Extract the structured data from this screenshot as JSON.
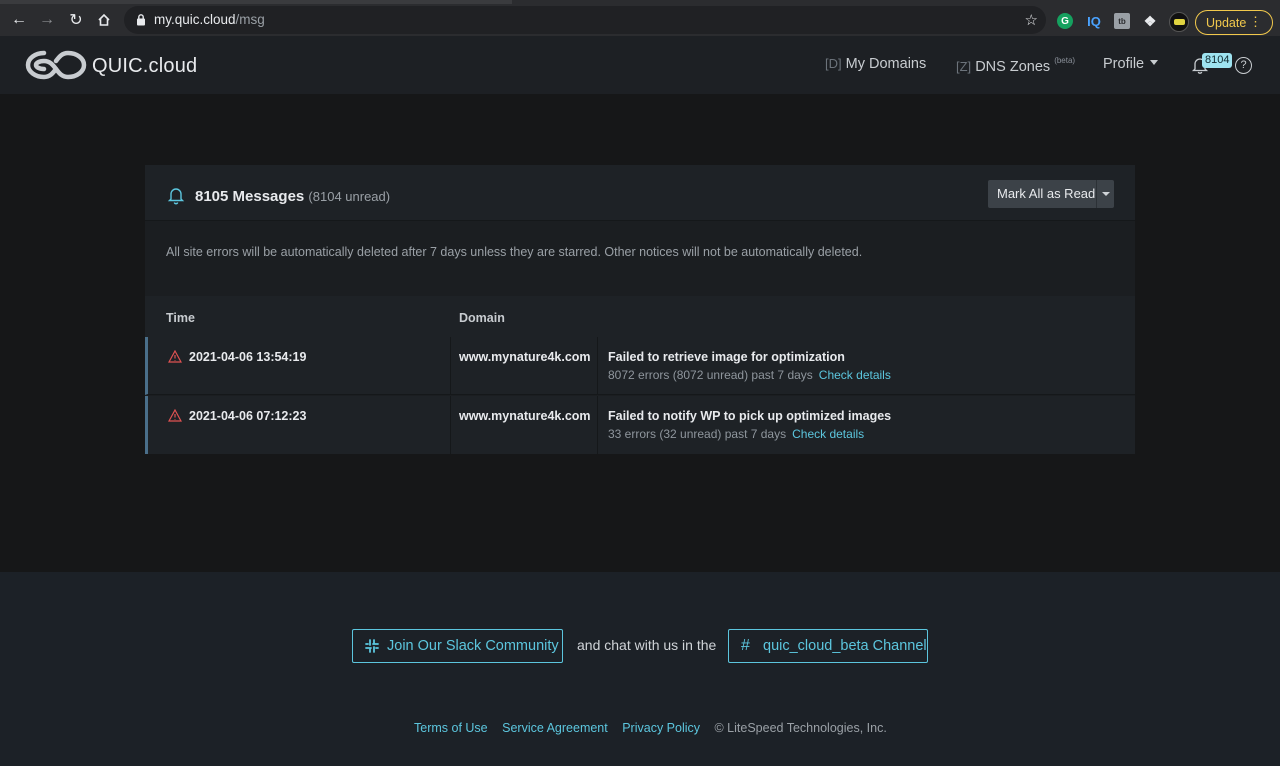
{
  "browser": {
    "url_host": "my.quic.cloud",
    "url_path": "/msg",
    "update_label": "Update",
    "ext_g": "G",
    "ext_iq": "IQ",
    "ext_tb": "tb"
  },
  "header": {
    "brand": "QUIC.cloud",
    "nav": {
      "domains_key": "[D]",
      "domains_label": "My Domains",
      "dns_key": "[Z]",
      "dns_label": "DNS Zones",
      "dns_tag": "(beta)",
      "profile_label": "Profile"
    },
    "notification_count": "8104",
    "help_glyph": "?"
  },
  "messages": {
    "title": "8105 Messages",
    "unread": "(8104 unread)",
    "mark_all_label": "Mark All as Read",
    "notice": "All site errors will be automatically deleted after 7 days unless they are starred. Other notices will not be automatically deleted.",
    "columns": {
      "time": "Time",
      "domain": "Domain"
    },
    "rows": [
      {
        "time": "2021-04-06 13:54:19",
        "domain": "www.mynature4k.com",
        "message": "Failed to retrieve image for optimization",
        "summary": "8072 errors (8072 unread) past 7 days",
        "link": "Check details"
      },
      {
        "time": "2021-04-06 07:12:23",
        "domain": "www.mynature4k.com",
        "message": "Failed to notify WP to pick up optimized images",
        "summary": "33 errors (32 unread) past 7 days",
        "link": "Check details"
      }
    ]
  },
  "footer": {
    "slack_label": "Join Our Slack Community",
    "middle_text": "and chat with us in the",
    "channel_label": "quic_cloud_beta Channel",
    "links": [
      "Terms of Use",
      "Service Agreement",
      "Privacy Policy"
    ],
    "copyright": "© LiteSpeed Technologies, Inc."
  },
  "colors": {
    "accent": "#5cc6de",
    "warning": "#e05252",
    "update": "#f2c94c"
  }
}
